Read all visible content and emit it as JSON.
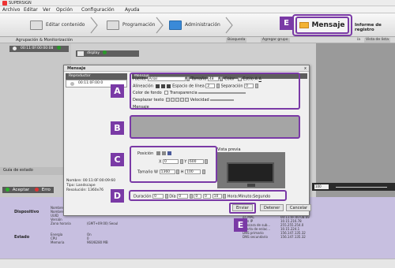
{
  "app": {
    "title": "SUPERSIGN"
  },
  "menu": [
    "Archivo",
    "Editar",
    "Ver",
    "Opción",
    "Configuración",
    "Ayuda"
  ],
  "toolbar": {
    "editar": "Editar contenido",
    "programacion": "Programación",
    "administracion": "Administración",
    "mensaje": "Mensaje",
    "informe": "Informe de registro",
    "callout": "E"
  },
  "secondbar": {
    "label": "Agrupación & Monitorización",
    "busqueda": "Búsqueda",
    "agregar": "Agregar grupo",
    "vista": "Vista de lista",
    "ia": "ía"
  },
  "leftpanel": {
    "time": "00:11:0F:00:00:08",
    "display": "display",
    "estado": "Guía de estado",
    "aceptar": "Aceptar",
    "err": "Erro"
  },
  "dialog": {
    "title": "Mensaje",
    "reproductor": "Reproductor",
    "repro_row": "00:11:0F:00:0",
    "mensaje_hdr": "Mensaje",
    "close": "x",
    "secA": {
      "fuente": "Fuente",
      "font": "Arial",
      "tamano": "Tamaño",
      "size": "48",
      "color": "Color",
      "estilo": "Estilo",
      "style_a": "A",
      "style_u": "A",
      "alineacion": "Alineación",
      "espacio": "Espacio de línea",
      "espacio_val": "2",
      "separacion": "Separación",
      "sep_val": "0",
      "color_fondo": "Color de fondo",
      "transparencia": "Transparencia",
      "desplazar": "Desplazar texto",
      "velocidad": "Velocidad",
      "mensaje": "Mensaje"
    },
    "secC": {
      "posicion": "Posición",
      "x_label": "X",
      "x_val": "0",
      "y_label": "Y",
      "y_val": "600",
      "tamano": "Tamaño",
      "w_label": "W",
      "w_val": "1360",
      "h_label": "H",
      "h_val": "100"
    },
    "vista": "Vista previa",
    "info": {
      "nombre": "Nombre: 00:11:0F:00:09:60",
      "tipo": "Tipo: Landscape",
      "resolucion": "Resolución: 1360x76"
    },
    "secD": {
      "duracion": "Duración",
      "dur_val": "0",
      "dia": "Día",
      "dia_val": "0",
      "h_val": "0",
      "m_val": "0",
      "s_val": "10",
      "formato": "Hora:Minuto:Segundo"
    },
    "buttons": {
      "enviar": "Enviar",
      "detener": "Detener",
      "cancelar": "Cancelar"
    },
    "callouts": {
      "a": "A",
      "b": "B",
      "c": "C",
      "d": "D"
    }
  },
  "bottompanel": {
    "dispositivo": "Dispositivo",
    "estado": "Estado",
    "left_keys": [
      "Nombre",
      "Nombre",
      "UUID",
      "Versión",
      "Zona horaria"
    ],
    "zona_val": "(GMT+09:00) Seoul",
    "estado_keys": [
      "Energía",
      "CPU",
      "Memoria"
    ],
    "estado_vals": [
      "On",
      "0",
      "960/8280 MB"
    ],
    "right_keys": [
      "ón MAC",
      "ción IP",
      "Máscara de sub...",
      "Puerta de enlac...",
      "DNS primario",
      "DNS secundario"
    ],
    "right_vals": [
      "00:11:0F:00:08:69",
      "10.15.216.78",
      "255.255.254.0",
      "10.15.224.1",
      "156.147.135.32",
      "156.147.135.32"
    ],
    "ip_label": "IP"
  },
  "slider": {
    "pct": "100"
  },
  "colors": {
    "accent": "#7a3aa6",
    "green": "#2a9a2a",
    "bottom_bg": "#c7bfe0"
  }
}
